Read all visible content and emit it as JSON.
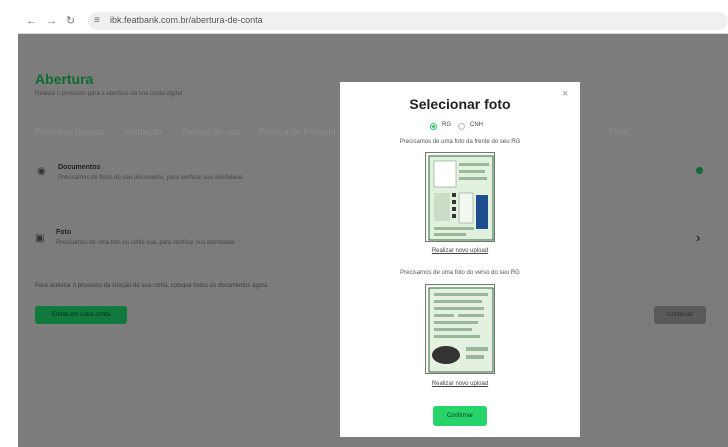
{
  "browser": {
    "url": "ibk.featbank.com.br/abertura-de-conta",
    "back_icon": "arrow-left-icon",
    "forward_icon": "arrow-right-icon",
    "reload_icon": "reload-icon",
    "site_info_icon": "site-settings-icon"
  },
  "page": {
    "title": "Abertura",
    "subtitle": "Realize o processo para a abertura da sua conta digital",
    "steps": [
      "Primeiros passos",
      "Validação",
      "Termos de uso",
      "Política de Privacid",
      "Final"
    ],
    "documents": {
      "title": "Documentos",
      "description": "Precisamos de fotos do seu documento, para verificar sua identidade."
    },
    "photo": {
      "title": "Foto",
      "description": "Precisamos de uma foto ou selfie sua, para verificar sua identidade"
    },
    "help_text": "Para acelerar o processo da criação de sua conta, coloque todos os documentos agora",
    "enter_button": "Entrar em outra conta",
    "continue_button": "Continuar"
  },
  "modal": {
    "title": "Selecionar foto",
    "close": "×",
    "options": [
      {
        "label": "RG",
        "selected": true
      },
      {
        "label": "CNH",
        "selected": false
      }
    ],
    "front_prompt": "Precisamos de uma foto da frente do seu RG",
    "back_prompt": "Precisamos de uma foto do verso do seu RG",
    "reupload_front": "Realizar novo upload",
    "reupload_back": "Realizar novo upload",
    "confirm_button": "Confirmar"
  },
  "colors": {
    "accent": "#27d46a",
    "brand_green": "#0f6b37",
    "overlay": "#7c7c7c"
  }
}
